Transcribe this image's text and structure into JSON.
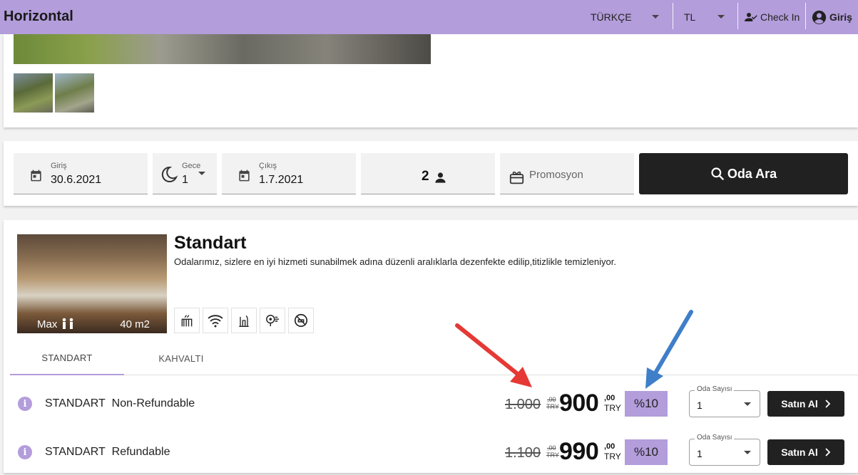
{
  "header": {
    "brand": "Horizontal",
    "language": "TÜRKÇE",
    "currency": "TL",
    "checkin_label": "Check In",
    "login_label": "Giriş",
    "bg_color": "#b39ddb"
  },
  "gallery": {
    "thumbnails": [
      "thumb-1",
      "thumb-2"
    ]
  },
  "search": {
    "checkin_label": "Giriş",
    "checkin_value": "30.6.2021",
    "nights_label": "Gece",
    "nights_value": "1",
    "checkout_label": "Çıkış",
    "checkout_value": "1.7.2021",
    "guests_value": "2",
    "promo_placeholder": "Promosyon",
    "search_button": "Oda Ara"
  },
  "room": {
    "title": "Standart",
    "description": "Odalarımız, sizlere en iyi hizmeti sunabilmek adına düzenli aralıklarla dezenfekte edilip,titizlikle temizleniyor.",
    "max_label": "Max",
    "size": "40 m2",
    "amenities": [
      "heater-icon",
      "wifi-icon",
      "minibar-icon",
      "hairdryer-icon",
      "no-smoking-icon"
    ],
    "tabs": [
      "STANDART",
      "KAHVALTI"
    ],
    "rates": [
      {
        "board": "STANDART",
        "type": "Non-Refundable",
        "old_price": "1.000",
        "old_cents": ",00",
        "old_currency": "TRY",
        "price": "900",
        "cents": ",00",
        "currency": "TRY",
        "discount": "%10",
        "qty_label": "Oda Sayısı",
        "qty_value": "1",
        "buy_label": "Satın Al"
      },
      {
        "board": "STANDART",
        "type": "Refundable",
        "old_price": "1.100",
        "old_cents": ",00",
        "old_currency": "TRY",
        "price": "990",
        "cents": ",00",
        "currency": "TRY",
        "discount": "%10",
        "qty_label": "Oda Sayısı",
        "qty_value": "1",
        "buy_label": "Satın Al"
      }
    ]
  },
  "annotations": {
    "red_arrow_color": "#e53935",
    "blue_arrow_color": "#3f7fc9"
  }
}
